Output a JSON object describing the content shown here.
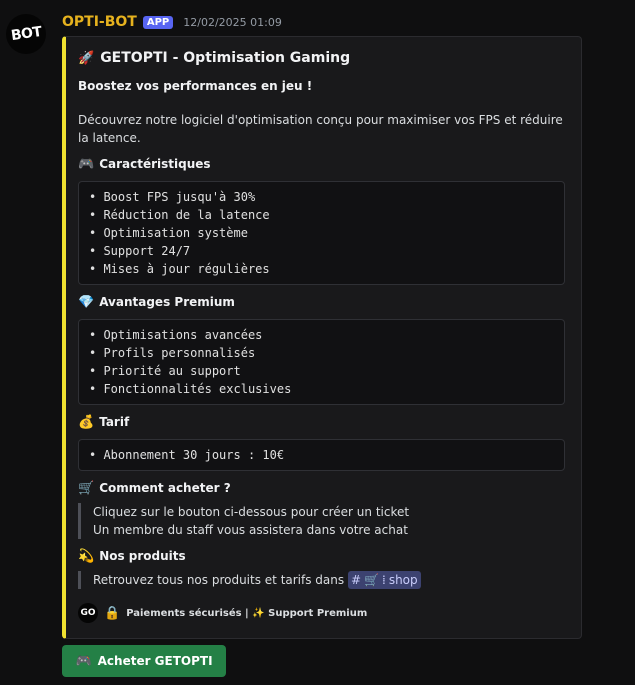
{
  "message": {
    "avatar_text": "BOT",
    "username": "OPTI-BOT",
    "badge": "APP",
    "timestamp": "12/02/2025 01:09"
  },
  "embed": {
    "accent_color": "#f0e130",
    "title": "GETOPTI - Optimisation Gaming",
    "title_icon": "rocket-icon",
    "desc_bold": "Boostez vos performances en jeu !",
    "desc": "Découvrez notre logiciel d'optimisation conçu pour maximiser vos FPS et réduire la latence.",
    "fields": {
      "features": {
        "name": "Caractéristiques",
        "icon": "gamepad-icon",
        "lines": "• Boost FPS jusqu'à 30%\n• Réduction de la latence\n• Optimisation système\n• Support 24/7\n• Mises à jour régulières"
      },
      "premium": {
        "name": "Avantages Premium",
        "icon": "gem-icon",
        "lines": "• Optimisations avancées\n• Profils personnalisés\n• Priorité au support\n• Fonctionnalités exclusives"
      },
      "pricing": {
        "name": "Tarif",
        "icon": "money-bag-icon",
        "lines": "• Abonnement 30 jours : 10€"
      },
      "howto": {
        "name": "Comment acheter ?",
        "icon": "cart-icon",
        "line1": "Cliquez sur le bouton ci-dessous pour créer un ticket",
        "line2": "Un membre du staff vous assistera dans votre achat"
      },
      "products": {
        "name": "Nos produits",
        "icon": "dizzy-icon",
        "text": "Retrouvez tous nos produits et tarifs dans",
        "channel": "shop"
      }
    },
    "footer": {
      "icon_text": "GO",
      "text": "Paiements sécurisés | ✨ Support Premium"
    }
  },
  "button": {
    "label": "Acheter GETOPTI",
    "color": "#248046"
  }
}
